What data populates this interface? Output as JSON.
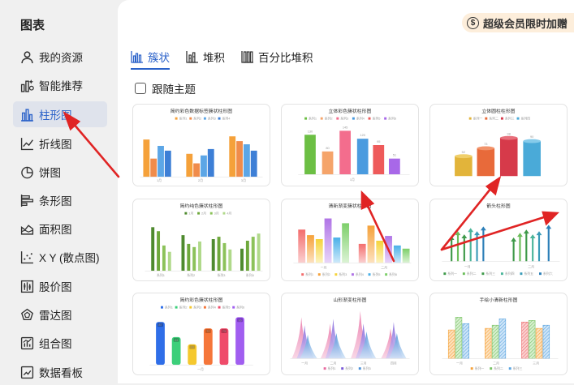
{
  "sidebar": {
    "title": "图表",
    "items": [
      {
        "label": "我的资源",
        "icon": "user-icon"
      },
      {
        "label": "智能推荐",
        "icon": "smart-recommend-icon"
      },
      {
        "label": "柱形图",
        "icon": "column-chart-icon",
        "active": true
      },
      {
        "label": "折线图",
        "icon": "line-chart-icon"
      },
      {
        "label": "饼图",
        "icon": "pie-chart-icon"
      },
      {
        "label": "条形图",
        "icon": "bar-chart-icon"
      },
      {
        "label": "面积图",
        "icon": "area-chart-icon"
      },
      {
        "label": "X Y (散点图)",
        "icon": "scatter-chart-icon"
      },
      {
        "label": "股价图",
        "icon": "stock-chart-icon"
      },
      {
        "label": "雷达图",
        "icon": "radar-chart-icon"
      },
      {
        "label": "组合图",
        "icon": "combo-chart-icon"
      },
      {
        "label": "数据看板",
        "icon": "dashboard-icon"
      }
    ]
  },
  "promo": {
    "coin": "$",
    "text": "超级会员限时加赠"
  },
  "tabs": [
    {
      "label": "簇状",
      "icon": "clustered-column-icon",
      "active": true
    },
    {
      "label": "堆积",
      "icon": "stacked-column-icon"
    },
    {
      "label": "百分比堆积",
      "icon": "percent-stacked-column-icon"
    }
  ],
  "follow_theme": {
    "label": "跟随主题",
    "checked": false
  },
  "accent": "#2b62c9",
  "templates": [
    {
      "title": "简约彩色数据标签簇状柱形图",
      "legend": [
        "系列1",
        "系列2",
        "系列3",
        "系列4"
      ],
      "xlabels": [
        "1月",
        "2月",
        "3月"
      ]
    },
    {
      "title": "立体彩色簇状柱形图",
      "legend": [
        "系列1",
        "系列2",
        "系列3",
        "系列4",
        "系列5",
        "系列6"
      ],
      "values": [
        "130",
        "80",
        "145",
        "120",
        "95",
        "51"
      ],
      "xlabels": [
        "1月"
      ]
    },
    {
      "title": "立体圆柱柱形图",
      "legend": [
        "系列一",
        "系列二",
        "系列三",
        "系列四"
      ],
      "values": [
        "52",
        "73",
        "98",
        "90"
      ]
    },
    {
      "title": "简约纯色簇状柱形图",
      "legend": [
        "1月",
        "2月",
        "3月",
        "4月"
      ],
      "xlabels": [
        "系列1",
        "系列2",
        "系列3",
        "系列4"
      ]
    },
    {
      "title": "清新渐变簇状柱形图",
      "legend": [
        "系列1",
        "系列2",
        "系列3",
        "系列4",
        "系列5",
        "系列6"
      ],
      "xlabels": [
        "一月",
        "二月"
      ]
    },
    {
      "title": "箭头柱形图",
      "legend": [
        "系列一",
        "系列二",
        "系列三",
        "系列四",
        "系列五",
        "系列六"
      ],
      "xlabels": [
        "一月",
        "二月"
      ]
    },
    {
      "title": "简约彩色簇状柱形图",
      "legend": [
        "系列1",
        "系列2",
        "系列3",
        "系列4",
        "系列5",
        "系列6"
      ],
      "values": [
        "87",
        "44",
        "33",
        "72",
        "73",
        "96"
      ],
      "xlabels": [
        "一月"
      ]
    },
    {
      "title": "山形渐变柱形图",
      "legend": [
        "系列1",
        "系列2",
        "系列3"
      ],
      "xlabels": [
        "一月",
        "二月",
        "三月",
        "四月"
      ]
    },
    {
      "title": "手绘小清新柱形图",
      "legend": [
        "系列一",
        "系列二",
        "系列三"
      ],
      "xlabels": [
        "一月",
        "二月",
        "三月"
      ]
    }
  ]
}
